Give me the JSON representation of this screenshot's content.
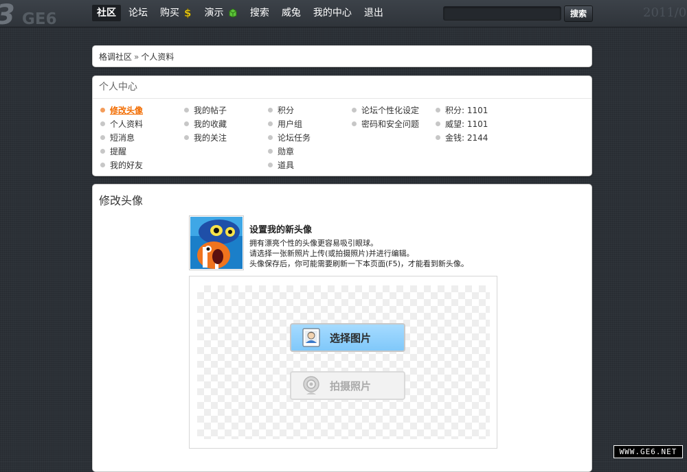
{
  "header": {
    "logo_text": "GE6",
    "nav": [
      {
        "label": "社区",
        "active": true
      },
      {
        "label": "论坛"
      },
      {
        "label": "购买",
        "icon": "dollar-icon"
      },
      {
        "label": "演示",
        "icon": "green-box-icon"
      },
      {
        "label": "搜索"
      },
      {
        "label": "威兔"
      },
      {
        "label": "我的中心"
      },
      {
        "label": "退出"
      }
    ],
    "search_button": "搜索",
    "date_text": "2011/0"
  },
  "breadcrumb": {
    "home": "格调社区",
    "separator": "»",
    "current": "个人资料"
  },
  "center": {
    "title": "个人中心",
    "col1": [
      "修改头像",
      "个人资料",
      "短消息",
      "提醒",
      "我的好友"
    ],
    "col2": [
      "我的帖子",
      "我的收藏",
      "我的关注"
    ],
    "col3": [
      "积分",
      "用户组",
      "论坛任务",
      "勋章",
      "道具"
    ],
    "col4": [
      "论坛个性化设定",
      "密码和安全问题"
    ],
    "stats": [
      "积分: 1101",
      "威望: 1101",
      "金钱: 2144"
    ]
  },
  "main": {
    "title": "修改头像",
    "heading": "设置我的新头像",
    "lines": [
      "拥有漂亮个性的头像更容易吸引眼球。",
      "请选择一张新照片上传(或拍摄照片)并进行编辑。",
      "头像保存后，你可能需要刷新一下本页面(F5)，才能看到新头像。"
    ],
    "choose_button": "选择图片",
    "capture_button": "拍摄照片"
  },
  "watermark": "WWW.GE6.NET",
  "colors": {
    "accent_orange": "#f26c00",
    "button_blue": "#8fd0fc",
    "page_bg": "#2b3036"
  }
}
